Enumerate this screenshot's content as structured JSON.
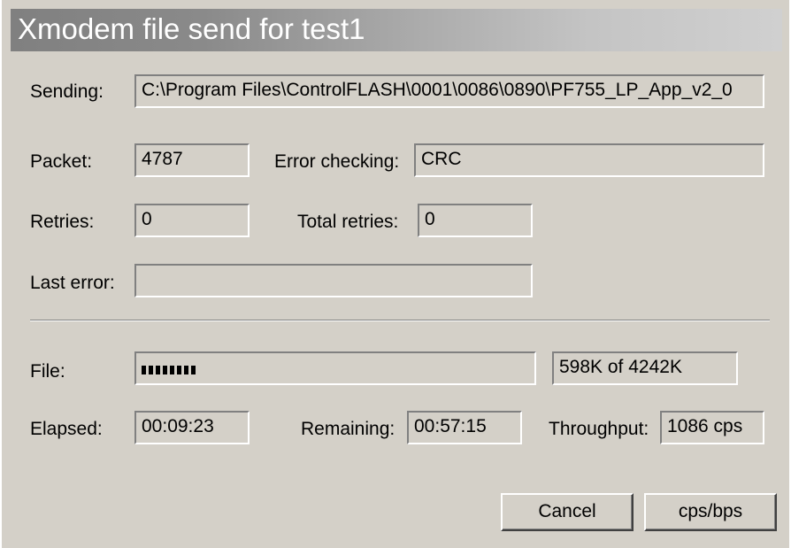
{
  "window": {
    "title": "Xmodem file send for test1"
  },
  "sending": {
    "label": "Sending:",
    "value": "C:\\Program Files\\ControlFLASH\\0001\\0086\\0890\\PF755_LP_App_v2_0"
  },
  "packet": {
    "label": "Packet:",
    "value": "4787"
  },
  "error_checking": {
    "label": "Error checking:",
    "value": "CRC"
  },
  "retries": {
    "label": "Retries:",
    "value": "0"
  },
  "total_retries": {
    "label": "Total retries:",
    "value": "0"
  },
  "last_error": {
    "label": "Last error:",
    "value": ""
  },
  "file": {
    "label": "File:",
    "progress_fraction": 0.141,
    "size_text": "598K of 4242K"
  },
  "elapsed": {
    "label": "Elapsed:",
    "value": "00:09:23"
  },
  "remaining": {
    "label": "Remaining:",
    "value": "00:57:15"
  },
  "throughput": {
    "label": "Throughput:",
    "value": "1086 cps"
  },
  "buttons": {
    "cancel": "Cancel",
    "cps_bps": "cps/bps"
  }
}
